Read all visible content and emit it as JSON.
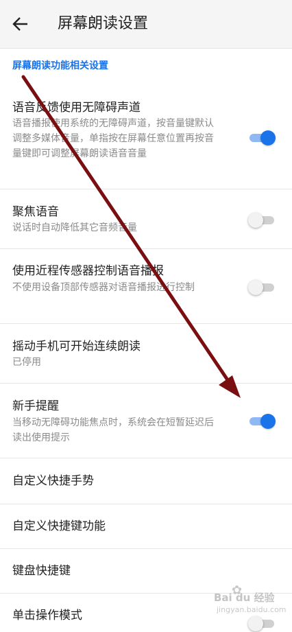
{
  "header": {
    "title": "屏幕朗读设置",
    "back_icon": "arrow-left-icon"
  },
  "section": {
    "label": "屏幕朗读功能相关设置"
  },
  "settings": [
    {
      "title": "语音反馈使用无障碍声道",
      "summary": "语音播报使用系统的无障碍声道，按音量键默认调整多媒体音量，单指按在屏幕任意位置再按音量键即可调整屏幕朗读语音音量",
      "toggle": true,
      "enabled": true
    },
    {
      "title": "聚焦语音",
      "summary": "说话时自动降低其它音频音量",
      "toggle": true,
      "enabled": false
    },
    {
      "title": "使用近程传感器控制语音播报",
      "summary": "不使用设备顶部传感器对语音播报进行控制",
      "toggle": true,
      "enabled": false
    },
    {
      "title": "摇动手机可开始连续朗读",
      "summary": "已停用"
    },
    {
      "title": "新手提醒",
      "summary": "当移动无障碍功能焦点时，系统会在短暂延迟后读出使用提示",
      "toggle": true,
      "enabled": true
    },
    {
      "title": "自定义快捷手势"
    },
    {
      "title": "自定义快捷键功能"
    },
    {
      "title": "键盘快捷键"
    },
    {
      "title": "单击操作模式",
      "toggle": true,
      "enabled": false
    }
  ],
  "watermark": {
    "brand": "Bai du 经验",
    "url": "jingyan.baidu.com"
  },
  "colors": {
    "accent": "#1a73e8",
    "annotation_arrow": "#7a0f12"
  }
}
